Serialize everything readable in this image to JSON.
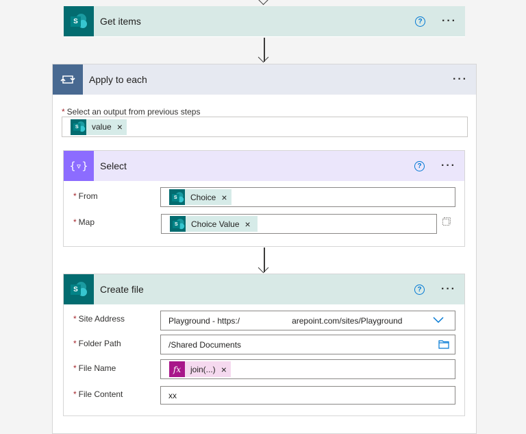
{
  "get_items": {
    "title": "Get items",
    "help": "?",
    "more": "···"
  },
  "apply": {
    "title": "Apply to each",
    "more": "···",
    "output_label": "Select an output from previous steps",
    "output_token": "value"
  },
  "select": {
    "title": "Select",
    "help": "?",
    "more": "···",
    "from_label": "From",
    "from_token": "Choice",
    "map_label": "Map",
    "map_token": "Choice Value"
  },
  "create": {
    "title": "Create file",
    "help": "?",
    "more": "···",
    "site_label": "Site Address",
    "site_value_left": "Playground - https:/",
    "site_value_right": "arepoint.com/sites/Playground",
    "folder_label": "Folder Path",
    "folder_value": "/Shared Documents",
    "filename_label": "File Name",
    "filename_token": "join(...)",
    "content_label": "File Content",
    "content_value": "xx"
  },
  "required_mark": "*",
  "remove_glyph": "×",
  "fx_glyph": "fx",
  "sp_letter": "S",
  "colors": {
    "sharepoint_header": "#d8e9e6",
    "loop_header": "#e6e9f1",
    "loop_icon": "#486991",
    "select_header": "#ebe6fb",
    "select_icon": "#8c6cff",
    "accent": "#0078d4"
  },
  "icons": {
    "sharepoint": "sharepoint-icon",
    "loop": "loop-icon",
    "select": "data-operation-icon",
    "help": "help-icon",
    "more": "more-icon",
    "chevron": "chevron-down-icon",
    "folder": "folder-icon",
    "function": "function-icon",
    "copy": "copy-icon"
  }
}
